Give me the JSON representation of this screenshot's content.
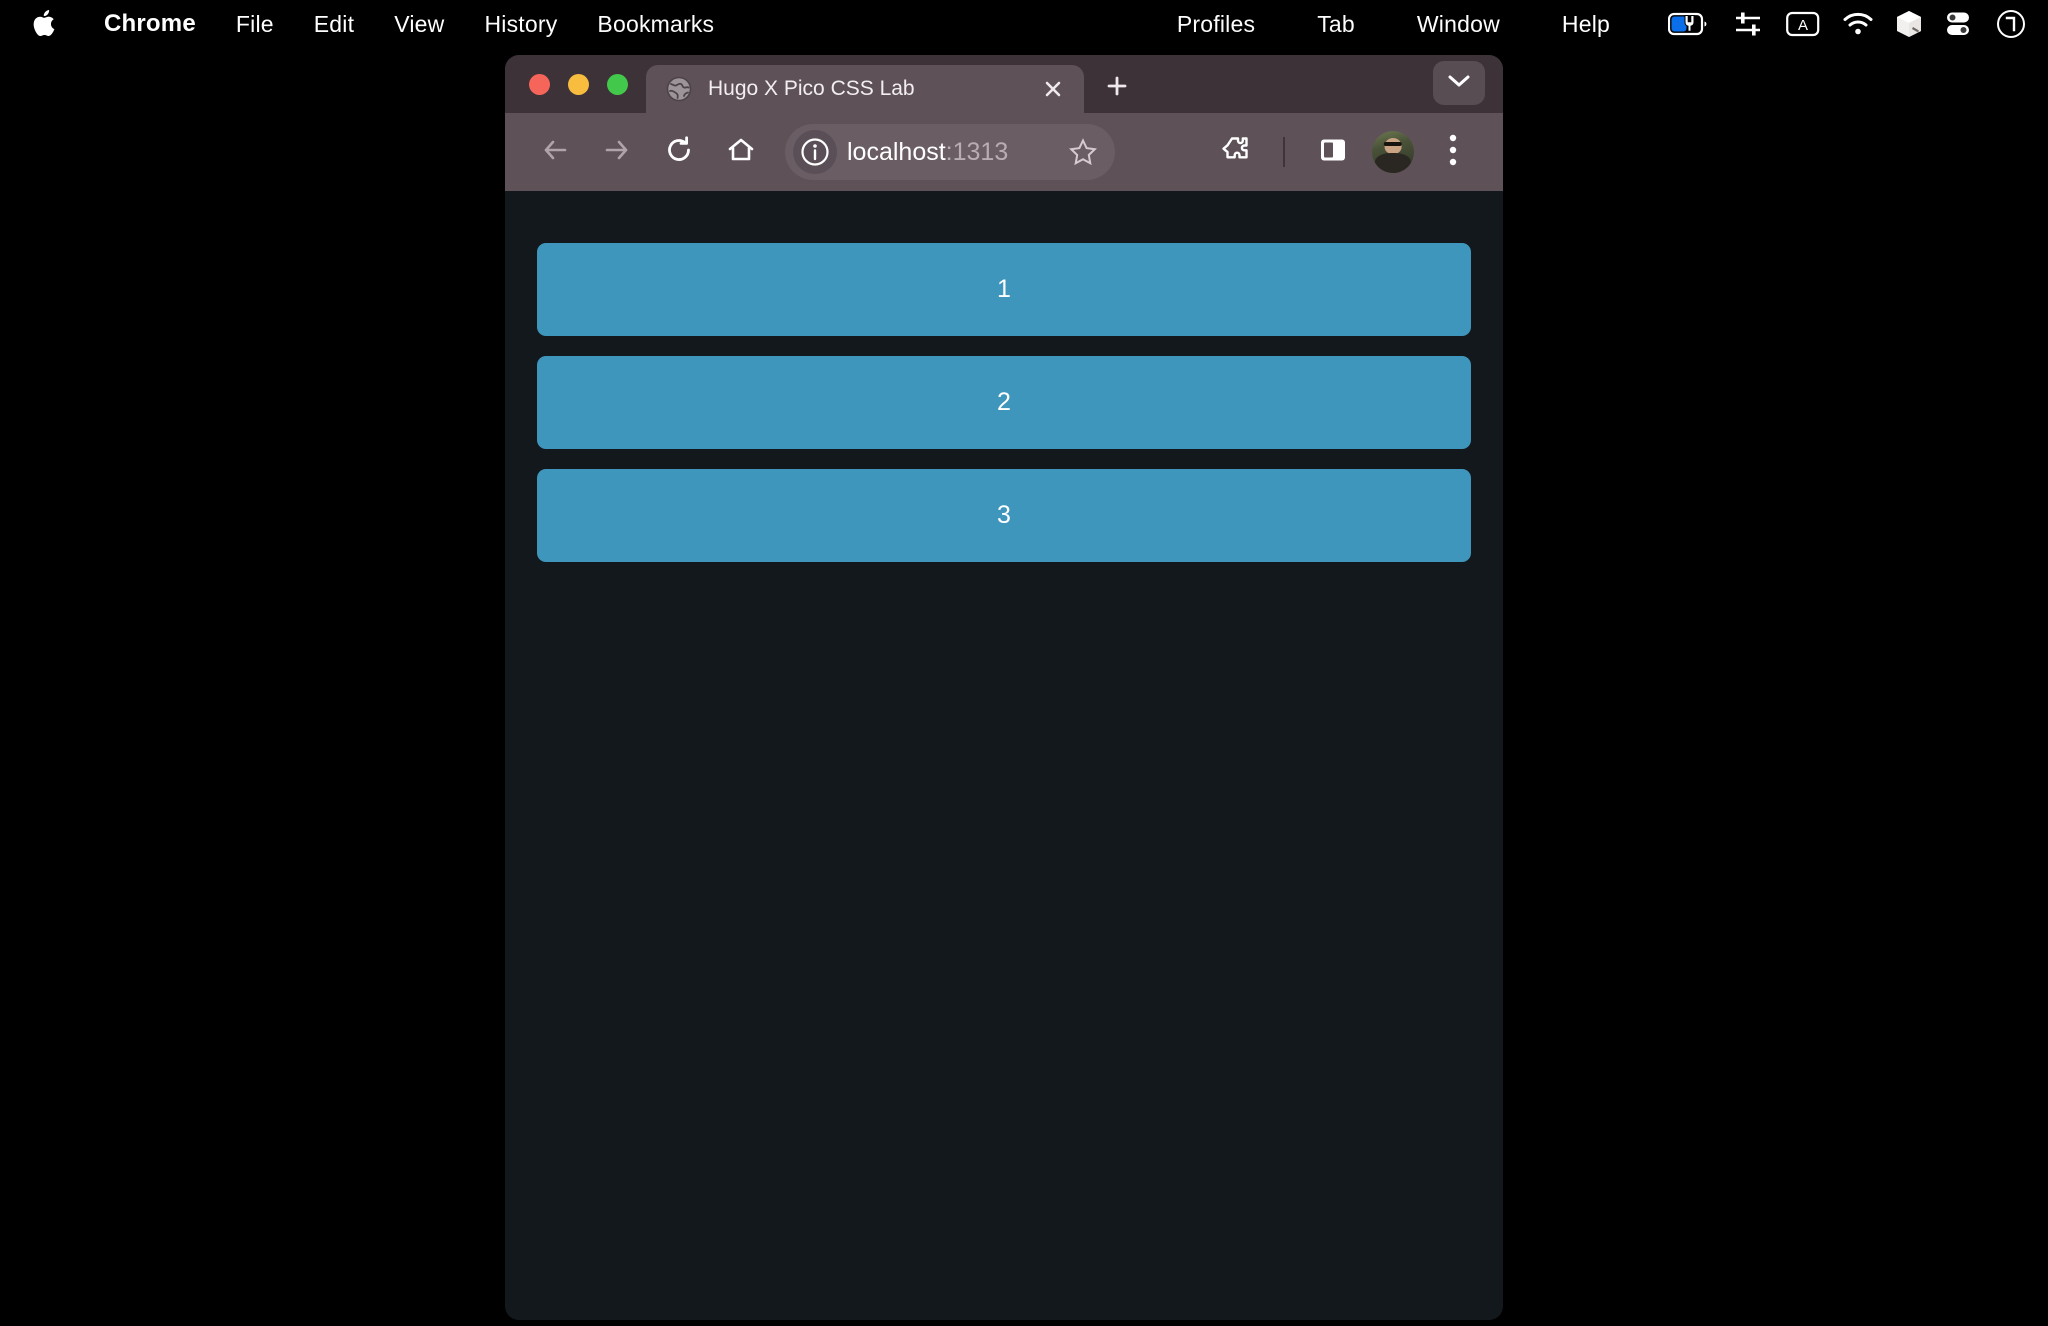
{
  "menubar": {
    "apple_icon": "apple-logo",
    "items": [
      {
        "label": "Chrome",
        "bold": true
      },
      {
        "label": "File",
        "bold": false
      },
      {
        "label": "Edit",
        "bold": false
      },
      {
        "label": "View",
        "bold": false
      },
      {
        "label": "History",
        "bold": false
      },
      {
        "label": "Bookmarks",
        "bold": false
      },
      {
        "label": "Profiles",
        "bold": false
      },
      {
        "label": "Tab",
        "bold": false
      },
      {
        "label": "Window",
        "bold": false
      },
      {
        "label": "Help",
        "bold": false
      }
    ],
    "status_icons": [
      "battery-charging-icon",
      "control-sliders-icon",
      "keyboard-input-a-icon",
      "wifi-icon",
      "raycast-icon",
      "control-center-icon",
      "siri-icon"
    ],
    "battery_accent": "#0a6fe8"
  },
  "window": {
    "traffic_lights": [
      "close",
      "minimize",
      "maximize"
    ],
    "traffic_colors": {
      "close": "#f6655a",
      "minimize": "#f8bd3f",
      "maximize": "#42c84a"
    }
  },
  "tabstrip": {
    "tab": {
      "title": "Hugo X Pico CSS Lab",
      "favicon": "globe-icon",
      "close_icon": "close-icon"
    },
    "new_tab_icon": "plus-icon",
    "tab_search_icon": "chevron-down-icon"
  },
  "toolbar": {
    "back_icon": "arrow-left-icon",
    "forward_icon": "arrow-right-icon",
    "reload_icon": "reload-icon",
    "home_icon": "home-icon",
    "omnibox": {
      "site_info_icon": "info-circle-icon",
      "host": "localhost",
      "port": ":1313",
      "bookmark_icon": "star-icon"
    },
    "extensions_icon": "puzzle-icon",
    "side_panel_icon": "side-panel-icon",
    "profile_icon": "avatar",
    "menu_icon": "three-dots-icon"
  },
  "page": {
    "background": "#13181c",
    "button_color": "#3f96bd",
    "buttons": [
      {
        "label": "1"
      },
      {
        "label": "2"
      },
      {
        "label": "3"
      }
    ]
  }
}
